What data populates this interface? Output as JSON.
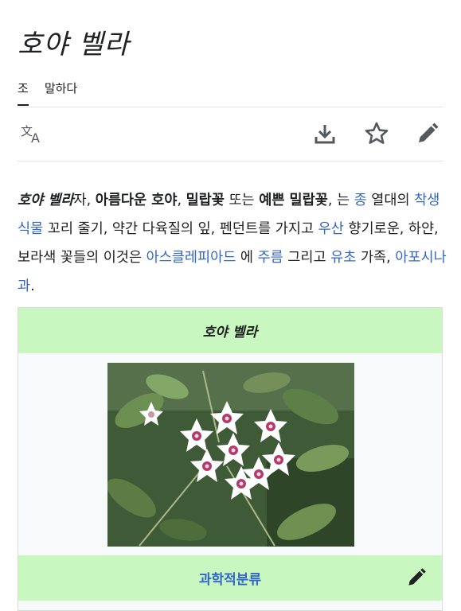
{
  "page": {
    "title": "호야 벨라"
  },
  "tabs": [
    {
      "label": "조"
    },
    {
      "label": "말하다"
    }
  ],
  "toolbar": {
    "language_icon": "translate-icon",
    "download_icon": "download-icon",
    "watch_icon": "star-icon",
    "edit_icon": "pencil-icon"
  },
  "lead": {
    "s1": "호야 벨라",
    "s2": "자, ",
    "s3": "아름다운 호야",
    "s4": ", ",
    "s5": "밀랍꽃",
    "s6": " 또는 ",
    "s7": "예쁜 밀랍꽃",
    "s8": ", 는 ",
    "s9": "종",
    "s10": " 열대의 ",
    "s11": "착생식물",
    "s12": " 꼬리 줄기, 약간 다육질의 잎, 펜던트를 가지고 ",
    "s13": "우산",
    "s14": " 향기로운, 하얀, 보라색 꽃들의 이것은 ",
    "s15": "아스클레피아드",
    "s16": " 에 ",
    "s17": "주름",
    "s18": " 그리고 ",
    "s19": "유초",
    "s20": " 가족, ",
    "s21": "아포시나과",
    "s22": "."
  },
  "infobox": {
    "header": "호야 벨라",
    "image": "flower-photo",
    "section_title": "과학적분류",
    "section_edit_icon": "pencil-icon"
  },
  "colors": {
    "link": "#3366cc",
    "infobox_header_bg": "#c8f7bf",
    "text": "#202122"
  }
}
